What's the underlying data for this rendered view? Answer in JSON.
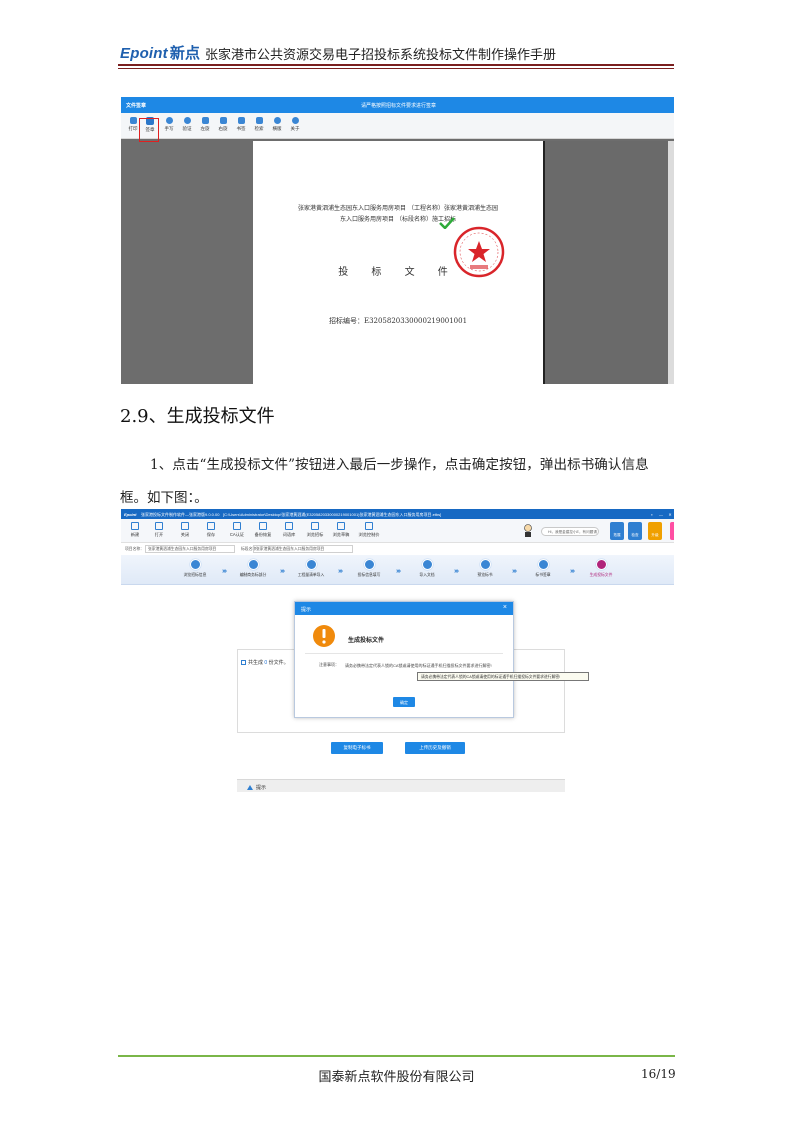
{
  "header": {
    "logo_latin": "Epoint",
    "logo_cn": "新点",
    "title": "张家港市公共资源交易电子招投标系统投标文件制作操作手册"
  },
  "shot1": {
    "window_label": "文件签章",
    "window_center": "请严格按照招标文件要求进行签章",
    "toolbar": [
      {
        "label": "打印",
        "icon": "printer-icon"
      },
      {
        "label": "签章",
        "icon": "stamp-icon"
      },
      {
        "label": "手写",
        "icon": "pen-icon"
      },
      {
        "label": "验证",
        "icon": "shield-icon"
      },
      {
        "label": "左旋",
        "icon": "rotate-left-icon"
      },
      {
        "label": "右旋",
        "icon": "rotate-right-icon"
      },
      {
        "label": "书签",
        "icon": "bookmark-icon"
      },
      {
        "label": "检索",
        "icon": "search-icon"
      },
      {
        "label": "横版",
        "icon": "landscape-icon"
      },
      {
        "label": "关于",
        "icon": "info-icon"
      }
    ],
    "doc": {
      "project_line1": "张家港黄泗浦生态园东入口服务用房项目 （工程名称）张家港黄泗浦生态园",
      "project_line2": "东入口服务用房项目 （标段名称）施工招标",
      "doc_title": "投 标 文 件",
      "bid_code": "招标编号：E3205820330000219001001"
    }
  },
  "section": {
    "heading": "2.9、生成投标文件",
    "para_line1": "1、点击“生成投标文件”按钮进入最后一步操作，点击确定按钮，弹出标书确认信息",
    "para_line2": "框。如下图：。"
  },
  "shot2": {
    "app_logo": "Epoint",
    "app_title": "张家港投标文件制作软件—张家港版9.0.0.00",
    "file_path": "[C:\\Users\\Administrator\\Desktop\\张家港黄泗浦(E3205820330000219001001)张家港黄泗浦生态园东入口服务用房项目.etbs]",
    "window_controls": [
      "▪",
      "—",
      "✕"
    ],
    "ribbon": [
      {
        "label": "新建",
        "icon": "new-file-icon"
      },
      {
        "label": "打开",
        "icon": "open-folder-icon"
      },
      {
        "label": "关闭",
        "icon": "close-file-icon"
      },
      {
        "label": "保存",
        "icon": "save-icon"
      },
      {
        "label": "CA认证",
        "icon": "ca-cert-icon"
      },
      {
        "label": "备份恢复",
        "icon": "backup-icon"
      },
      {
        "label": "词语库",
        "icon": "lexicon-icon"
      },
      {
        "label": "浏览招标",
        "icon": "browse-tender-icon"
      },
      {
        "label": "浏览草稿",
        "icon": "browse-draft-icon"
      },
      {
        "label": "浏览控制价",
        "icon": "browse-price-icon"
      }
    ],
    "search_placeholder": "Hi，我是金建控小E，有问题请",
    "tiles": [
      {
        "label": "拓展",
        "icon": "expand-tile-icon"
      },
      {
        "label": "检查",
        "icon": "check-tile-icon"
      },
      {
        "label": "升级",
        "icon": "upgrade-tile-icon"
      }
    ],
    "project_label": "项目名称：",
    "project_value": "张家港黄泗浦生态园东入口服务用房项目",
    "section_label": "标段名称：",
    "section_value": "张家港黄泗浦生态园东入口服务用房项目",
    "steps": [
      {
        "label": "浏览招标信息",
        "icon": "tender-info-icon",
        "active": false
      },
      {
        "label": "编制商务标部分",
        "icon": "business-part-icon",
        "active": false
      },
      {
        "label": "工程量清单导入",
        "icon": "quantity-import-icon",
        "active": false
      },
      {
        "label": "投标信息填写",
        "icon": "bid-info-icon",
        "active": false
      },
      {
        "label": "导入文档",
        "icon": "import-doc-icon",
        "active": false
      },
      {
        "label": "预览标书",
        "icon": "preview-icon",
        "active": false
      },
      {
        "label": "标书签章",
        "icon": "sign-icon",
        "active": false
      },
      {
        "label": "生成投标文件",
        "icon": "generate-file-icon",
        "active": true
      }
    ],
    "step_arrow": "›››",
    "generated_prefix": "共生成",
    "generated_count": "0",
    "generated_suffix": "份文件。",
    "dialog": {
      "head": "提示",
      "close": "×",
      "title": "生成投标文件",
      "note_key": "注意事项：",
      "note_text": "请务必携带法定代表人锁的CA锁或请使用的标证通手机扫描投标文件要求进行解密!",
      "ok": "确定"
    },
    "tooltip": "请务必携带法定代表人锁的CA锁或请使用的标证通手机扫描投标文件要求进行解密!",
    "btn_copy": "复制电子标书",
    "btn_upload": "上传历史及撤销",
    "tip_bar": "提示"
  },
  "footer": {
    "company": "国泰新点软件股份有限公司",
    "page": "16/19"
  },
  "colors": {
    "brand_blue": "#1e88e5",
    "header_rule": "#7a1f1f",
    "footer_rule": "#7ab648",
    "seal_red": "#d9252a",
    "active_step": "#b0247a"
  }
}
